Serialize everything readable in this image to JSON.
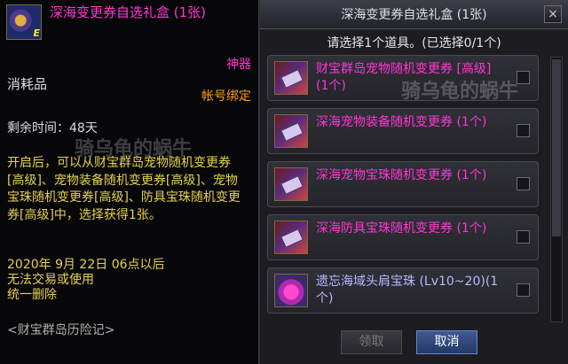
{
  "tooltip": {
    "title": "深海变更券自选礼盒 (1张)",
    "icon_badge": "E",
    "item_type": "消耗品",
    "grade": "神器",
    "binding": "帐号绑定",
    "remaining_time": "剩余时间：48天",
    "description": "开启后，可以从财宝群岛宠物随机变更券[高级]、宠物装备随机变更券[高级]、宠物宝珠随机变更券[高级]、防具宝珠随机变更券[高级]中，选择获得1张。",
    "date": "2020年 9月 22日 06点以后",
    "trade_rule": "无法交易或使用",
    "delete_rule": "统一删除",
    "source": "<财宝群岛历险记>"
  },
  "watermark": "骑乌龟的蜗牛",
  "dialog": {
    "title": "深海变更券自选礼盒 (1张)",
    "close_label": "×",
    "prompt": "请选择1个道具。(已选择0/1个)",
    "items": [
      {
        "name": "财宝群岛宠物随机变更券 [高级] (1个)",
        "icon": "ticket-icon"
      },
      {
        "name": "深海宠物装备随机变更券 (1个)",
        "icon": "ticket-icon"
      },
      {
        "name": "深海宠物宝珠随机变更券 (1个)",
        "icon": "ticket-icon"
      },
      {
        "name": "深海防具宝珠随机变更券 (1个)",
        "icon": "ticket-icon"
      },
      {
        "name": "遗忘海域头肩宝珠 (Lv10~20)(1个)",
        "icon": "gem-icon"
      }
    ],
    "claim_label": "领取",
    "cancel_label": "取消"
  },
  "colors": {
    "rare_pink": "#ff36d2",
    "bind_orange": "#ff9a18",
    "desc_yellow": "#e6d24e",
    "gem_blue": "#b9b8ff"
  }
}
